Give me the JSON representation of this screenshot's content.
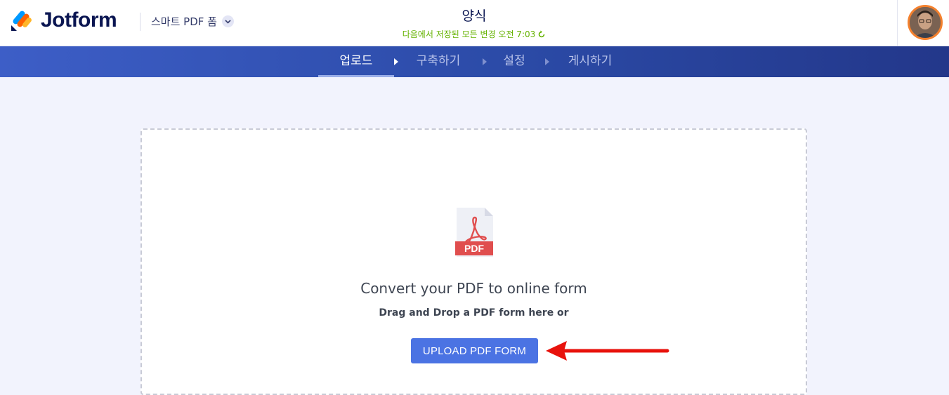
{
  "header": {
    "logo_text": "Jotform",
    "form_type_label": "스마트 PDF 폼",
    "form_title": "양식",
    "save_status": "다음에서 저장된 모든 변경 오전 7:03"
  },
  "nav": {
    "tabs": [
      {
        "label": "업로드",
        "active": true
      },
      {
        "label": "구축하기",
        "active": false
      },
      {
        "label": "설정",
        "active": false
      },
      {
        "label": "게시하기",
        "active": false
      }
    ]
  },
  "main": {
    "pdf_icon_label": "PDF",
    "convert_title": "Convert your PDF to online form",
    "drag_text": "Drag and Drop a PDF form here or",
    "upload_button_label": "UPLOAD PDF FORM"
  },
  "colors": {
    "brand_navy": "#0a1551",
    "nav_gradient_start": "#3d5ec7",
    "nav_gradient_end": "#23378a",
    "save_status_green": "#64b200",
    "upload_button": "#4b73e3",
    "pdf_red": "#e04e4e",
    "annotation_arrow": "#e8120c"
  },
  "icons": {
    "logo": "jotform-logo-icon",
    "form_type_toggle": "chevron-down-icon",
    "save_status": "refresh-icon",
    "pdf": "pdf-file-icon",
    "annotation": "red-arrow-icon"
  }
}
